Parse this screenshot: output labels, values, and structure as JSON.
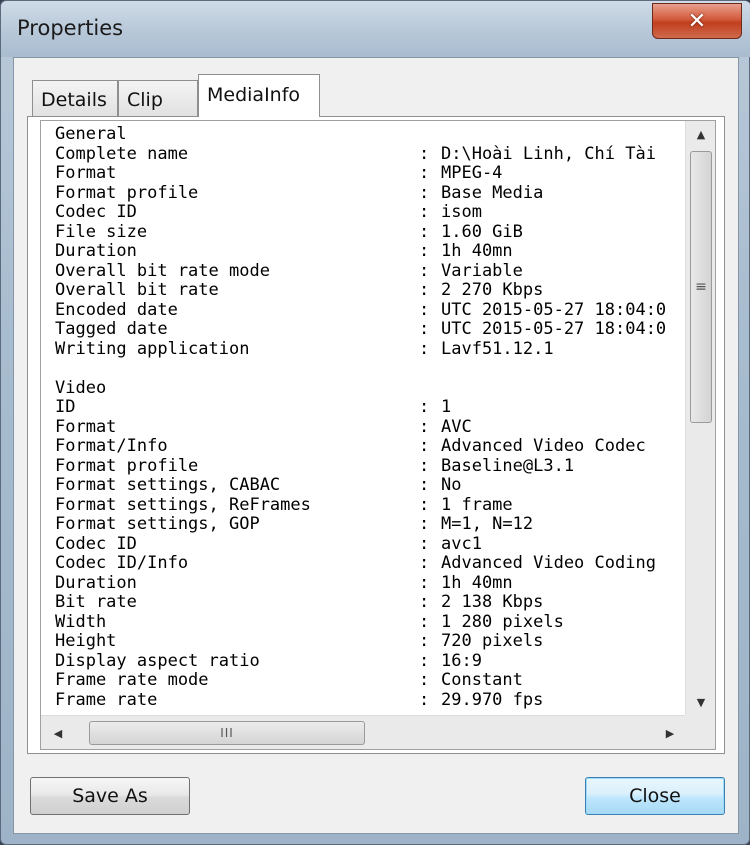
{
  "window": {
    "title": "Properties",
    "close_label": "✕"
  },
  "tabs": [
    {
      "label": "Details",
      "active": false
    },
    {
      "label": "Clip",
      "active": false
    },
    {
      "label": "MediaInfo",
      "active": true
    }
  ],
  "mediainfo": {
    "lines": [
      {
        "key": "General",
        "value": ""
      },
      {
        "key": "Complete name",
        "value": "D:\\Hoài Linh, Chí Tài"
      },
      {
        "key": "Format",
        "value": "MPEG-4"
      },
      {
        "key": "Format profile",
        "value": "Base Media"
      },
      {
        "key": "Codec ID",
        "value": "isom"
      },
      {
        "key": "File size",
        "value": "1.60 GiB"
      },
      {
        "key": "Duration",
        "value": "1h 40mn"
      },
      {
        "key": "Overall bit rate mode",
        "value": "Variable"
      },
      {
        "key": "Overall bit rate",
        "value": "2 270 Kbps"
      },
      {
        "key": "Encoded date",
        "value": "UTC 2015-05-27 18:04:0"
      },
      {
        "key": "Tagged date",
        "value": "UTC 2015-05-27 18:04:0"
      },
      {
        "key": "Writing application",
        "value": "Lavf51.12.1"
      },
      {
        "key": "",
        "value": ""
      },
      {
        "key": "Video",
        "value": ""
      },
      {
        "key": "ID",
        "value": "1"
      },
      {
        "key": "Format",
        "value": "AVC"
      },
      {
        "key": "Format/Info",
        "value": "Advanced Video Codec"
      },
      {
        "key": "Format profile",
        "value": "Baseline@L3.1"
      },
      {
        "key": "Format settings, CABAC",
        "value": "No"
      },
      {
        "key": "Format settings, ReFrames",
        "value": "1 frame"
      },
      {
        "key": "Format settings, GOP",
        "value": "M=1, N=12"
      },
      {
        "key": "Codec ID",
        "value": "avc1"
      },
      {
        "key": "Codec ID/Info",
        "value": "Advanced Video Coding"
      },
      {
        "key": "Duration",
        "value": "1h 40mn"
      },
      {
        "key": "Bit rate",
        "value": "2 138 Kbps"
      },
      {
        "key": "Width",
        "value": "1 280 pixels"
      },
      {
        "key": "Height",
        "value": "720 pixels"
      },
      {
        "key": "Display aspect ratio",
        "value": "16:9"
      },
      {
        "key": "Frame rate mode",
        "value": "Constant"
      },
      {
        "key": "Frame rate",
        "value": "29.970 fps"
      }
    ],
    "separator": ":"
  },
  "scrollbar": {
    "up_arrow": "▲",
    "down_arrow": "▼",
    "left_arrow": "◀",
    "right_arrow": "▶",
    "v_grip": "≡",
    "h_grip": "III"
  },
  "buttons": {
    "save_as": "Save As",
    "close": "Close"
  }
}
